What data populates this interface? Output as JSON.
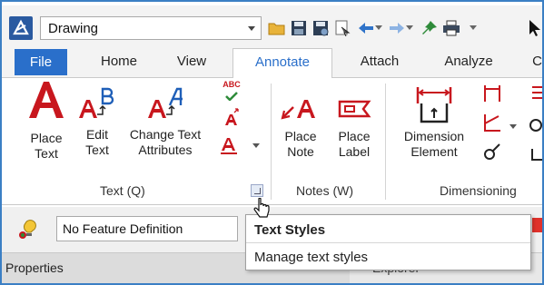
{
  "qat": {
    "workflow_value": "Drawing",
    "icons": [
      "open-folder-icon",
      "save-icon",
      "save-settings-icon",
      "compress-icon",
      "undo-icon",
      "redo-icon",
      "pin-icon",
      "print-icon",
      "pointer-icon"
    ]
  },
  "tabs": [
    "File",
    "Home",
    "View",
    "Annotate",
    "Attach",
    "Analyze",
    "C"
  ],
  "active_tab": "Annotate",
  "ribbon": {
    "text_group": {
      "label": "Text (Q)",
      "place_text": [
        "Place",
        "Text"
      ],
      "edit_text": [
        "Edit",
        "Text"
      ],
      "change_text_attributes": [
        "Change Text",
        "Attributes"
      ],
      "spell_check_glyph": "ABC"
    },
    "notes_group": {
      "label": "Notes (W)",
      "place_note": [
        "Place",
        "Note"
      ],
      "place_label": [
        "Place",
        "Label"
      ]
    },
    "dimensioning_group": {
      "label": "Dimensioning",
      "dimension_element": [
        "Dimension",
        "Element"
      ]
    }
  },
  "lower": {
    "feature_definition": "No Feature Definition"
  },
  "panes": {
    "properties": "Properties",
    "explorer": "Explorer"
  },
  "tooltip": {
    "title": "Text Styles",
    "description": "Manage text styles"
  },
  "colors": {
    "accent": "#2a6fca",
    "file_tab": "#2a6fca",
    "text_red": "#c8171e",
    "icon_blue": "#1f5fb8"
  }
}
